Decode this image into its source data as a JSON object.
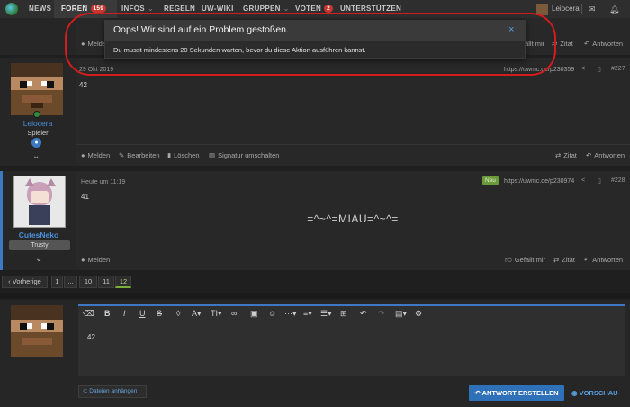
{
  "nav": {
    "items": [
      {
        "label": "NEWS"
      },
      {
        "label": "FOREN",
        "badge": "159"
      },
      {
        "label": "INFOS"
      },
      {
        "label": "REGELN"
      },
      {
        "label": "UW-WIKI"
      },
      {
        "label": "GRUPPEN"
      },
      {
        "label": "VOTEN",
        "badge": "2"
      },
      {
        "label": "UNTERSTÜTZEN"
      }
    ],
    "user": "Leiocera"
  },
  "modal": {
    "title": "Oops! Wir sind auf ein Problem gestoßen.",
    "message": "Du musst mindestens 20 Sekunden warten, bevor du diese Aktion ausführen kannst.",
    "close": "×"
  },
  "top_partial": {
    "melden": "Melden",
    "gefaellt": "Gefällt mir",
    "zitat": "Zitat",
    "antworten": "Antworten"
  },
  "posts": [
    {
      "user": "Leiocera",
      "role": "Spieler",
      "date": "29 Okt 2019",
      "link": "https://uwmc.de/p230359",
      "number": "#227",
      "content": "42",
      "actions": {
        "melden": "Melden",
        "bearbeiten": "Bearbeiten",
        "loeschen": "Löschen",
        "signatur": "Signatur umschalten",
        "zitat": "Zitat",
        "antworten": "Antworten"
      }
    },
    {
      "user": "CutesNeko",
      "role": "Trusty",
      "date": "Heute um 11:19",
      "new_badge": "Neu",
      "link": "https://uwmc.de/p230974",
      "number": "#228",
      "content": "41",
      "signature": "=^~^=MIAU=^~^=",
      "actions": {
        "melden": "Melden",
        "gefaellt": "Gefällt mir",
        "zitat": "Zitat",
        "antworten": "Antworten"
      }
    }
  ],
  "pager": {
    "prev": "‹ Vorherige",
    "pages": [
      "1",
      "...",
      "10",
      "11",
      "12"
    ],
    "current": "12"
  },
  "editor": {
    "content": "42",
    "attach": "Dateien anhängen",
    "submit": "ANTWORT ERSTELLEN",
    "preview": "VORSCHAU"
  },
  "colors": {
    "accent": "#5aa0e0",
    "highlight_oval": "#d11d1d",
    "badge": "#c8362f",
    "new_badge": "#6a9a3a"
  }
}
